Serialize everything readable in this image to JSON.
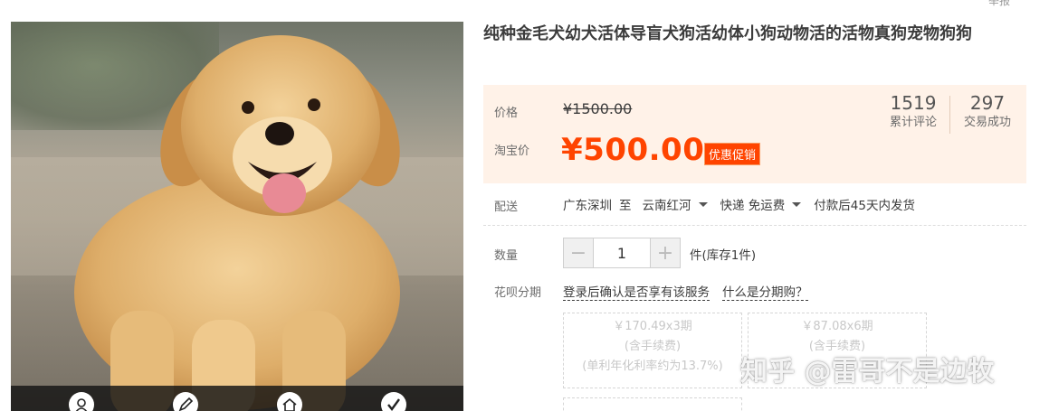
{
  "header": {
    "report_link": "举报"
  },
  "product": {
    "title": "纯种金毛犬幼犬活体导盲犬狗活幼体小狗动物活的活物真狗宠物狗狗"
  },
  "price": {
    "label": "价格",
    "original": "¥1500.00",
    "taobao_label": "淘宝价",
    "current": "¥500.00",
    "promo_badge": "优惠促销",
    "accent_color": "#ff4400"
  },
  "stats": {
    "reviews_count": "1519",
    "reviews_label": "累计评论",
    "deals_count": "297",
    "deals_label": "交易成功"
  },
  "delivery": {
    "label": "配送",
    "from": "广东深圳",
    "to_word": "至",
    "destination": "云南红河",
    "method": "快递 免运费",
    "dispatch": "付款后45天内发货"
  },
  "quantity": {
    "label": "数量",
    "minus": "−",
    "value": "1",
    "plus": "+",
    "stock_text": "件(库存1件)"
  },
  "installment": {
    "label": "花呗分期",
    "login_text": "登录后确认是否享有该服务",
    "what_link": "什么是分期购？",
    "plans": [
      {
        "amount": "￥170.49x3期",
        "fee": "(含手续费)",
        "rate": "(单利年化利率约为13.7%)"
      },
      {
        "amount": "￥87.08x6期",
        "fee": "(含手续费)",
        "rate": ""
      }
    ]
  },
  "photo": {
    "toolbar_icons": [
      "avatar-icon",
      "edit-icon",
      "home-icon",
      "check-icon"
    ]
  },
  "watermark": "知乎 @雷哥不是边牧"
}
